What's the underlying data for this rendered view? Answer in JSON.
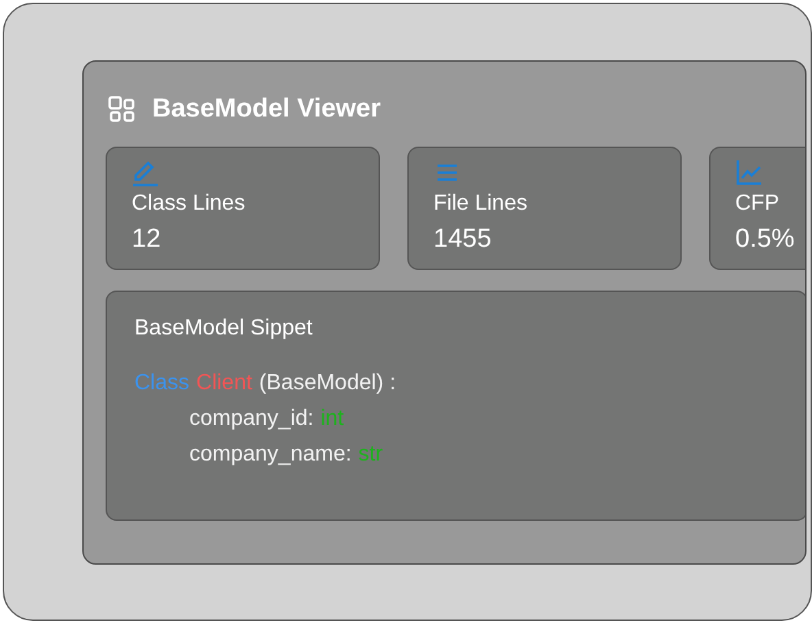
{
  "panel": {
    "title": "BaseModel Viewer"
  },
  "stats": [
    {
      "label": "Class Lines",
      "value": "12"
    },
    {
      "label": "File Lines",
      "value": "1455"
    },
    {
      "label": "CFP",
      "value": "0.5%"
    }
  ],
  "snippet": {
    "title": "BaseModel Sippet",
    "lines": [
      {
        "tokens": [
          {
            "text": "Class",
            "color": "#3b93ee"
          },
          {
            "text": "Client",
            "color": "#f25555"
          },
          {
            "text": "(BaseModel) :",
            "color": "#f2f2f2"
          }
        ],
        "children": [
          {
            "tokens": [
              {
                "text": "company_id:",
                "color": "#f2f2f2"
              },
              {
                "text": "int",
                "color": "#1db31d"
              }
            ]
          },
          {
            "tokens": [
              {
                "text": "company_name:",
                "color": "#f2f2f2"
              },
              {
                "text": "str",
                "color": "#1db31d"
              }
            ]
          }
        ]
      }
    ]
  }
}
